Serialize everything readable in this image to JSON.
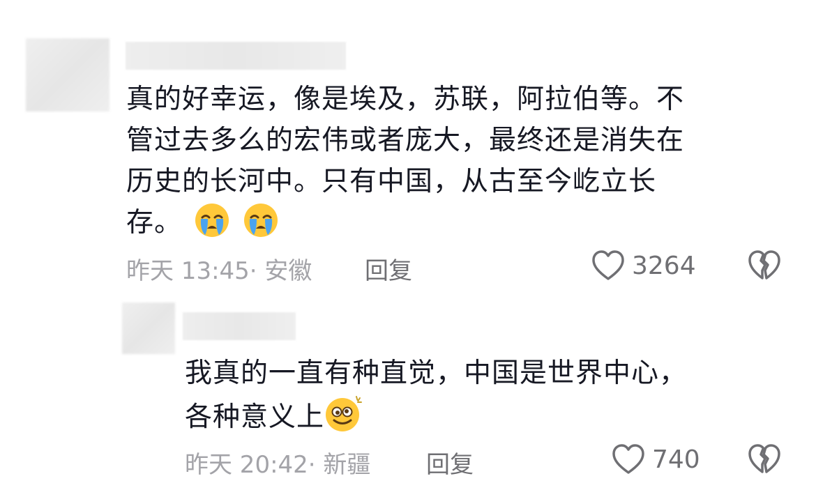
{
  "comments": [
    {
      "text_lines": [
        "真的好幸运，像是埃及，苏联，阿拉伯等。不",
        "管过去多么的宏伟或者庞大，最终还是消失在",
        "历史的长河中。只有中国，从古至今屹立长",
        "存。"
      ],
      "emojis": [
        "crying-face-emoji",
        "crying-face-emoji"
      ],
      "time": "昨天 13:45",
      "location": "· 安徽",
      "reply_label": "回复",
      "likes": "3264"
    },
    {
      "text_lines": [
        "我真的一直有种直觉，中国是世界中心，",
        "各种意义上"
      ],
      "emojis": [
        "dizzy-smile-emoji"
      ],
      "time": "昨天 20:42",
      "location": "· 新疆",
      "reply_label": "回复",
      "likes": "740"
    }
  ],
  "colors": {
    "text": "#161823",
    "meta": "#a3a3a8",
    "action": "#6f6f73",
    "emoji_yellow": "#ffc83a",
    "tear_blue": "#4aa3f0"
  }
}
